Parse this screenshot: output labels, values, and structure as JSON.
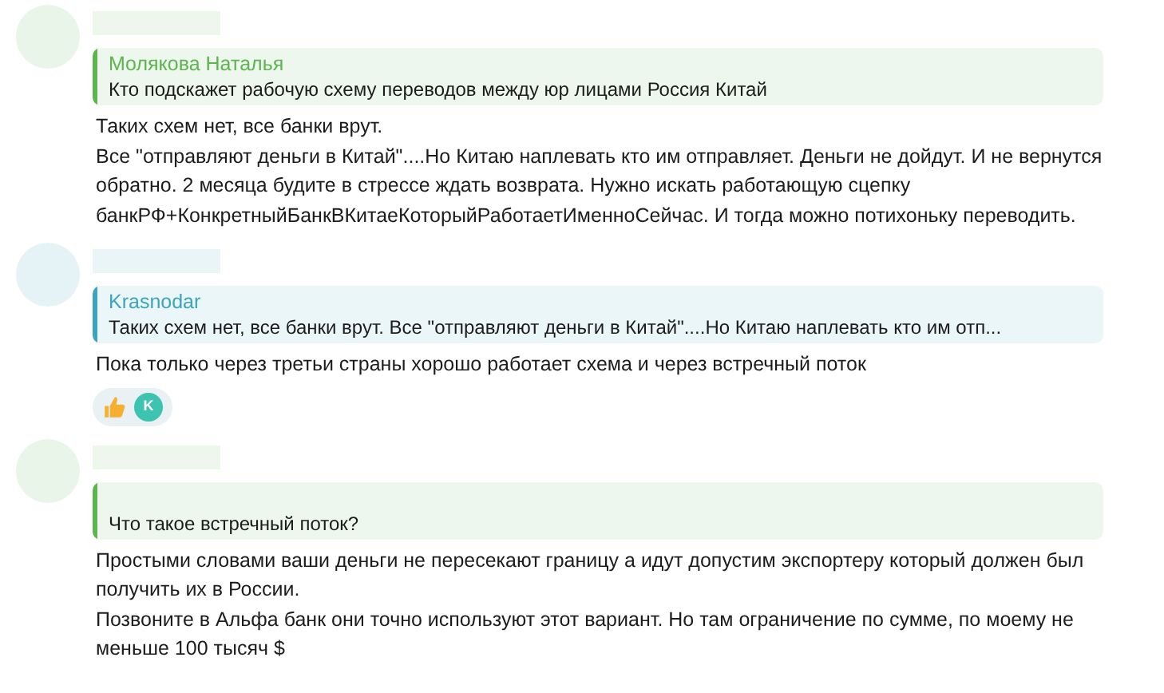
{
  "messages": [
    {
      "color": "#5db54f",
      "reply": {
        "author": "Молякова Наталья",
        "text": "Кто подскажет рабочую схему переводов между юр лицами Россия Китай"
      },
      "body": [
        "Таких схем нет, все банки врут.",
        "Все \"отправляют деньги в Китай\"....Но Китаю наплевать кто им отправляет. Деньги не дойдут. И не вернутся обратно. 2 месяца будите в стрессе ждать возврата. Нужно искать работающую сцепку банкРФ+КонкретныйБанкВКитаеКоторыйРаботаетИменноСейчас. И тогда можно потихоньку переводить."
      ]
    },
    {
      "color": "#3ea4bd",
      "reply": {
        "author": "Krasnodar",
        "text": "Таких схем нет, все банки врут. Все \"отправляют деньги в Китай\"....Но Китаю наплевать кто им отп..."
      },
      "body": [
        "Пока только через третьи страны хорошо работает схема и через встречный поток"
      ],
      "reactions": [
        {
          "kind": "thumbs-up"
        },
        {
          "kind": "avatar",
          "text": "K",
          "color": "#3ec3b0"
        }
      ]
    },
    {
      "color": "#5db54f",
      "reply": {
        "text": "Что такое встречный поток?"
      },
      "body": [
        "Простыми словами ваши деньги не пересекают границу а идут допустим экспортеру который должен был получить их в России.",
        "Позвоните в Альфа банк они точно используют этот вариант. Но там ограничение по сумме, по моему не меньше 100 тысяч $"
      ]
    }
  ]
}
